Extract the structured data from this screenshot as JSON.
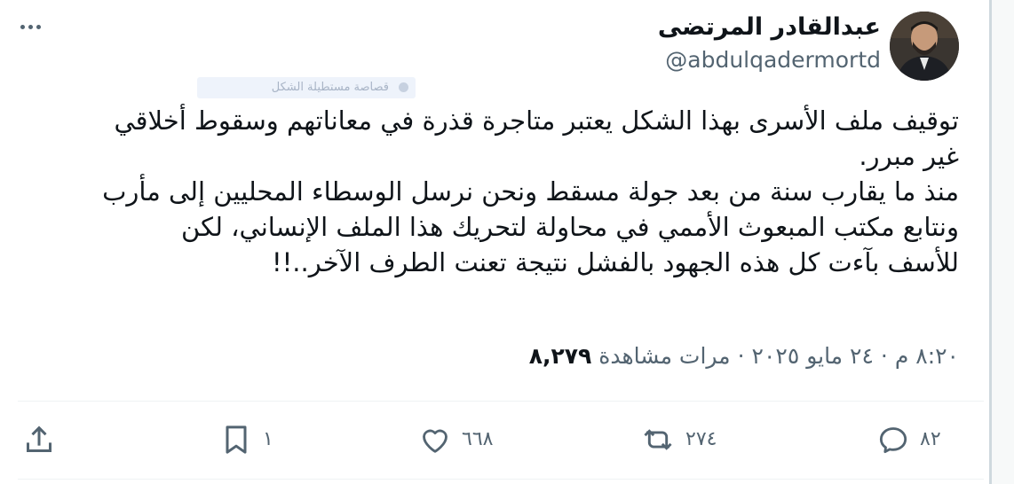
{
  "author": {
    "display_name": "عبدالقادر المرتضى",
    "handle": "@abdulqadermortd"
  },
  "watermark": {
    "text": "قصاصة مستطيلة الشكل"
  },
  "tweet": {
    "lines": [
      "توقيف ملف الأسرى بهذا الشكل يعتبر متاجرة قذرة في معاناتهم وسقوط أخلاقي",
      "غير مبرر.",
      "منذ ما يقارب سنة من بعد جولة مسقط ونحن نرسل الوسطاء المحليين إلى مأرب",
      "ونتابع مكتب المبعوث الأممي في محاولة لتحريك هذا الملف الإنساني، لكن",
      "للأسف بآءت كل هذه الجهود بالفشل نتيجة تعنت الطرف الآخر..!!"
    ]
  },
  "meta": {
    "time": "٨:٢٠ م",
    "date": "٢٤ مايو ٢٠٢٥",
    "separator": "·",
    "views_count": "٨,٢٧٩",
    "views_label": "مرات مشاهدة"
  },
  "actions": {
    "reply_count": "٨٢",
    "retweet_count": "٢٧٤",
    "like_count": "٦٦٨",
    "bookmark_count": "١"
  },
  "icons": [
    "more-icon",
    "reply-icon",
    "retweet-icon",
    "like-icon",
    "bookmark-icon",
    "share-icon"
  ],
  "colors": {
    "text": "#0f1419",
    "secondary": "#536471",
    "divider": "#eff3f4"
  }
}
